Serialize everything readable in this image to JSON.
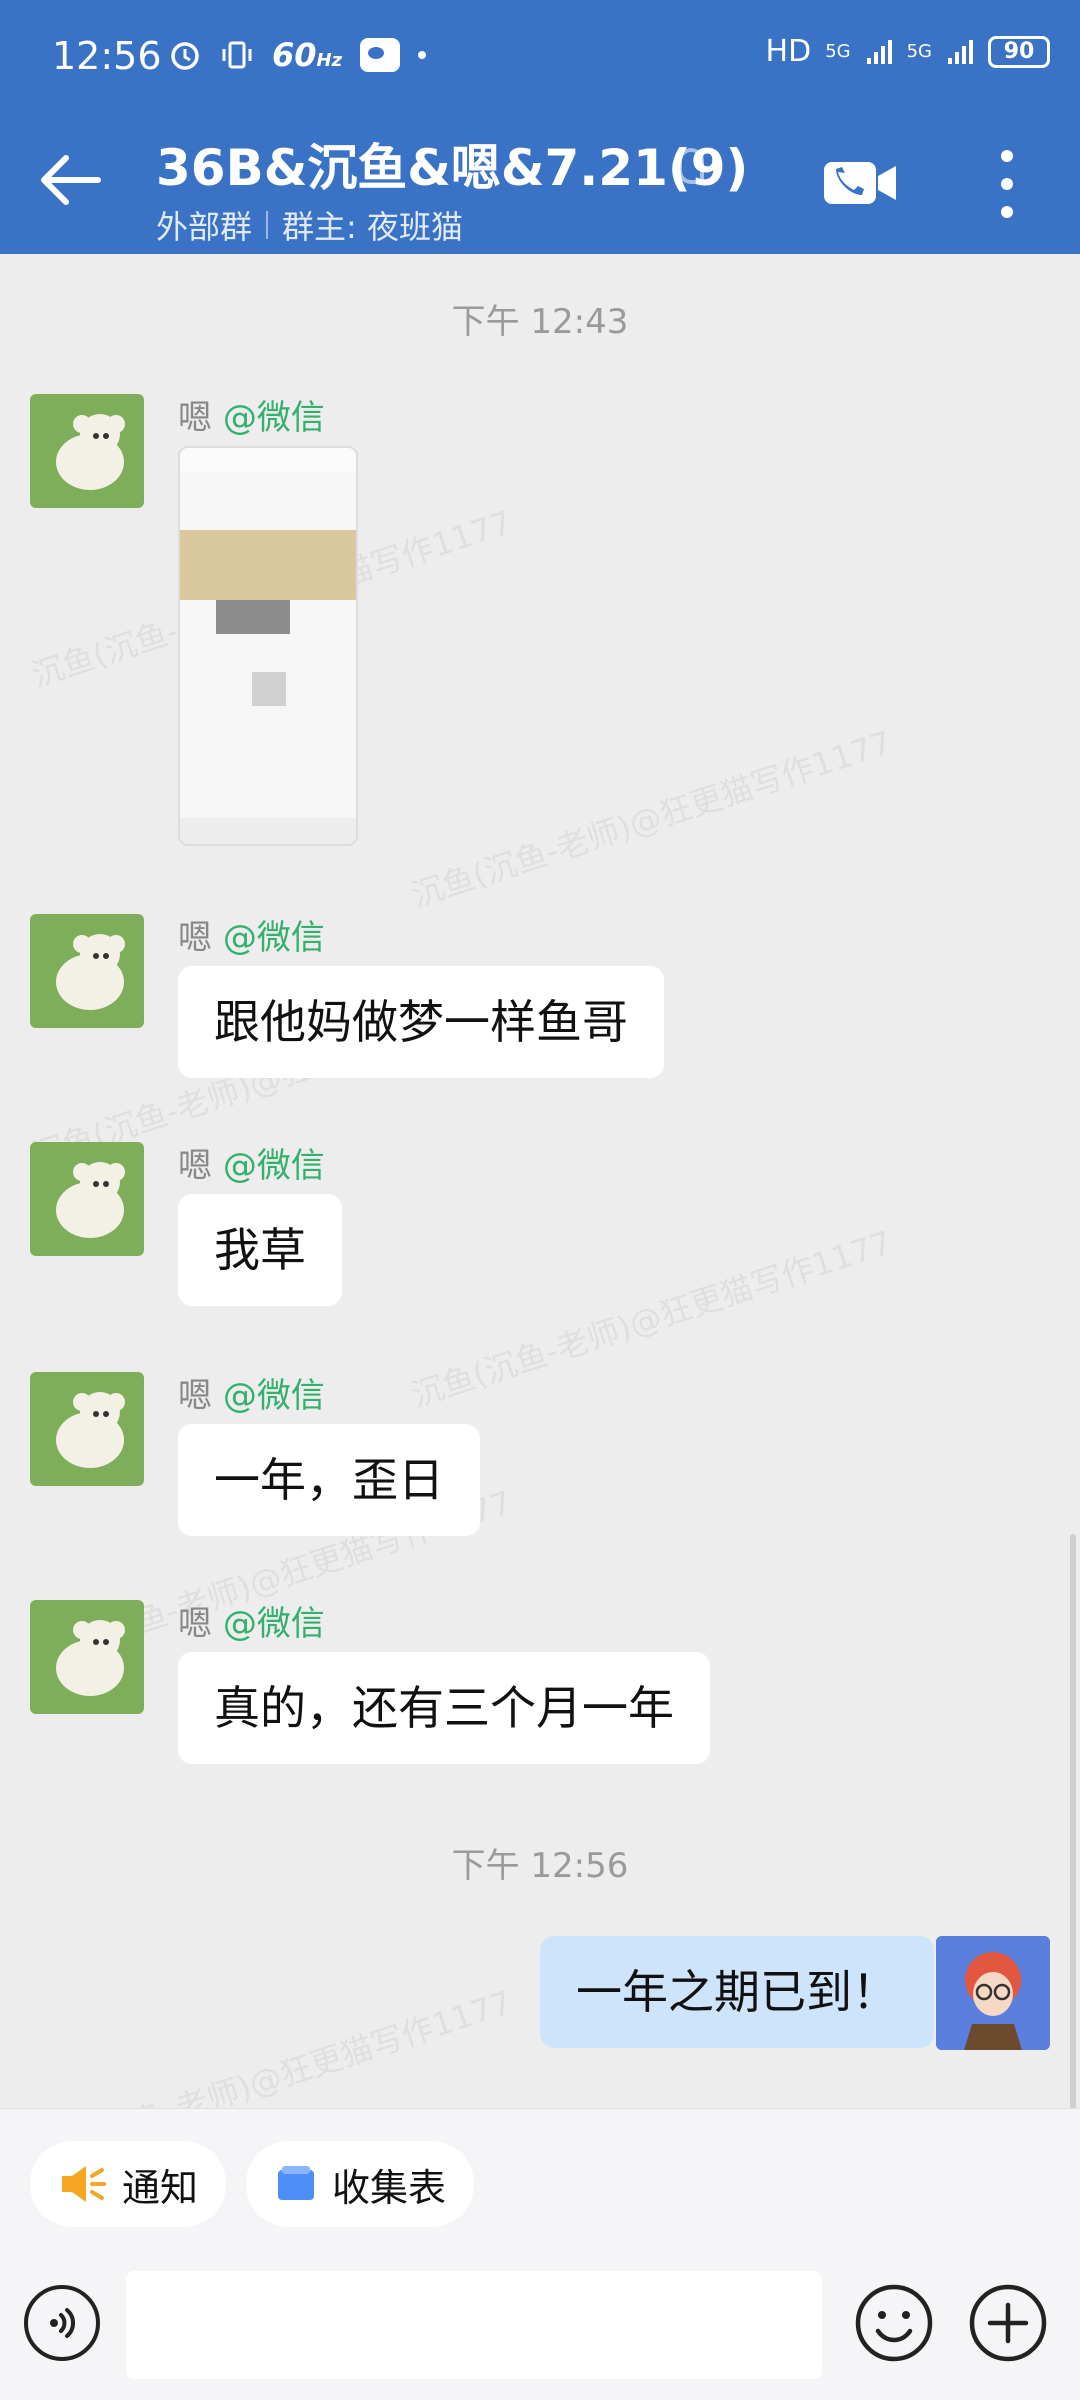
{
  "status_bar": {
    "time": "12:56",
    "refresh_rate": "60",
    "refresh_unit": "Hz",
    "network_label": "HD",
    "signal_1": "5G",
    "signal_2": "5G",
    "battery": "90"
  },
  "header": {
    "title": "36B&沉鱼&嗯&7.21(9)",
    "group_type": "外部群",
    "owner": "群主: 夜班猫"
  },
  "messages": [
    {
      "kind": "time",
      "text": "下午 12:43"
    },
    {
      "kind": "received",
      "sender": "嗯",
      "tag": "@微信",
      "type": "image"
    },
    {
      "kind": "received",
      "sender": "嗯",
      "tag": "@微信",
      "text": "跟他妈做梦一样鱼哥"
    },
    {
      "kind": "received",
      "sender": "嗯",
      "tag": "@微信",
      "text": "我草"
    },
    {
      "kind": "received",
      "sender": "嗯",
      "tag": "@微信",
      "text": "一年，歪日"
    },
    {
      "kind": "received",
      "sender": "嗯",
      "tag": "@微信",
      "text": "真的，还有三个月一年"
    },
    {
      "kind": "time",
      "text": "下午 12:56"
    },
    {
      "kind": "sent",
      "text": "一年之期已到！"
    }
  ],
  "watermark": "沉鱼(沉鱼-老师)@狂更猫写作1177",
  "shortcuts": [
    {
      "label": "通知",
      "icon": "megaphone-icon"
    },
    {
      "label": "收集表",
      "icon": "form-icon"
    }
  ],
  "input": {
    "placeholder": ""
  },
  "colors": {
    "header": "#3a73c6",
    "sender_tag": "#33b06b",
    "my_bubble": "#cde4fb"
  }
}
